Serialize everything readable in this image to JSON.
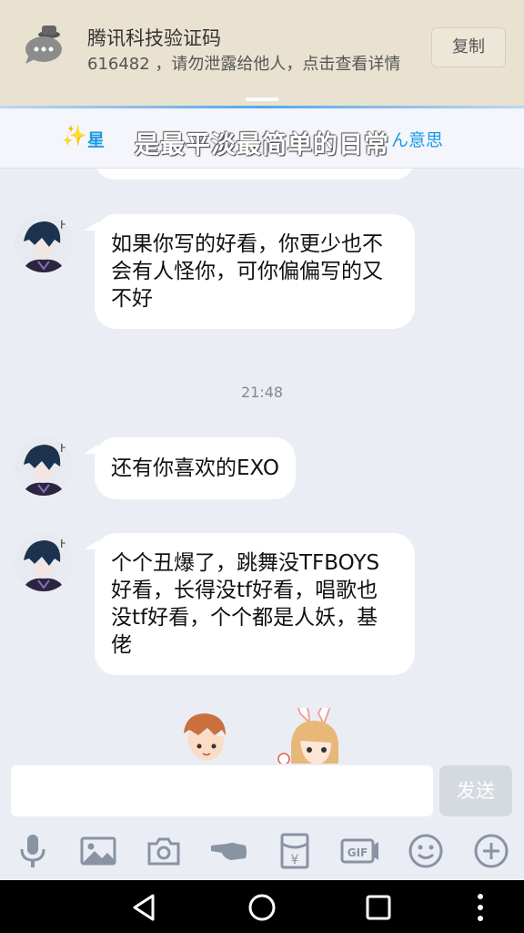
{
  "notification": {
    "title": "腾讯科技验证码",
    "body": "616482 ，请勿泄露给他人，点击查看详情",
    "action_label": "复制",
    "icon": "chat-bubble-icon"
  },
  "group_header": {
    "left_text": "星",
    "center_text": "是最平淡最简单的日常",
    "right_text": "ん意思",
    "sparkle_icon": "sparkle-icon"
  },
  "messages": [
    {
      "text": "如果你写的好看，你更少也不会有人怪你，可你偏偏写的又不好"
    },
    {
      "timestamp": "21:48"
    },
    {
      "text": "还有你喜欢的EXO"
    },
    {
      "text": "个个丑爆了，跳舞没TFBOYS好看，长得没tf好看，唱歌也没tf好看，个个都是人妖，基佬"
    }
  ],
  "input": {
    "placeholder": "",
    "value": "",
    "send_label": "发送"
  },
  "toolbar": [
    "microphone-icon",
    "image-icon",
    "camera-icon",
    "poke-icon",
    "red-packet-icon",
    "gif-icon",
    "emoji-icon",
    "plus-icon"
  ],
  "navbar": [
    "back-icon",
    "home-icon",
    "recents-icon",
    "more-icon"
  ],
  "colors": {
    "accent": "#1a9be6",
    "background": "#eaedf4",
    "notification_bg": "#e9e2d1"
  }
}
